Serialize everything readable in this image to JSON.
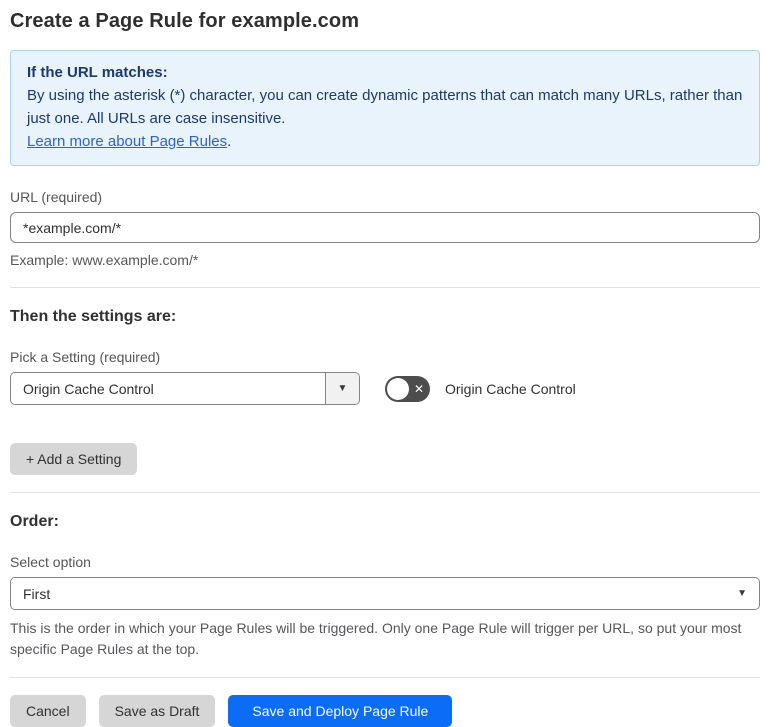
{
  "page": {
    "title": "Create a Page Rule for example.com"
  },
  "info_box": {
    "heading": "If the URL matches:",
    "body": "By using the asterisk (*) character, you can create dynamic patterns that can match many URLs, rather than just one. All URLs are case insensitive.",
    "link": "Learn more about Page Rules",
    "link_suffix": "."
  },
  "url_section": {
    "label": "URL (required)",
    "value": "*example.com/*",
    "helper": "Example: www.example.com/*"
  },
  "settings_section": {
    "heading": "Then the settings are:",
    "picker_label": "Pick a Setting (required)",
    "picker_value": "Origin Cache Control",
    "toggle_label": "Origin Cache Control",
    "toggle_state": "off",
    "add_setting_label": "+ Add a Setting"
  },
  "order_section": {
    "heading": "Order:",
    "select_label": "Select option",
    "select_value": "First",
    "helper": "This is the order in which your Page Rules will be triggered. Only one Page Rule will trigger per URL, so put your most specific Page Rules at the top."
  },
  "actions": {
    "cancel": "Cancel",
    "save_draft": "Save as Draft",
    "save_deploy": "Save and Deploy Page Rule"
  },
  "icons": {
    "caret_down": "▼",
    "toggle_off_x": "✕"
  },
  "colors": {
    "primary_blue": "#0b6df6",
    "info_bg": "#e8f3fc",
    "info_border": "#abd3f1",
    "info_text": "#1d3a6d",
    "link_blue": "#2b65cc",
    "button_gray": "#d6d6d6",
    "toggle_bg": "#4d4d4d"
  }
}
